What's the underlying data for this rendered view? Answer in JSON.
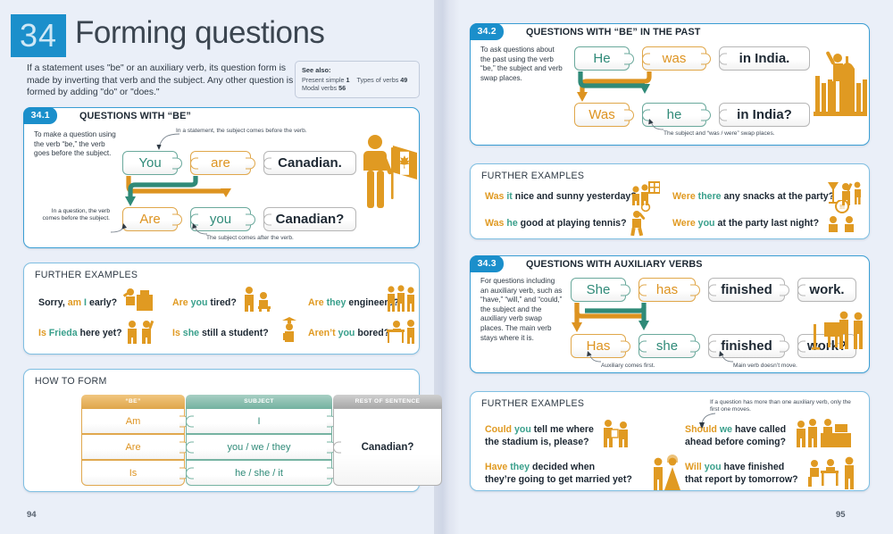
{
  "header": {
    "chapter_number": "34",
    "title": "Forming questions",
    "intro": "If a statement uses \"be\" or an auxiliary verb, its question form is made by inverting that verb and the subject. Any other question is formed by adding \"do\" or \"does.\"",
    "see_also": {
      "label": "See also:",
      "refs": [
        {
          "text": "Present simple",
          "page": "1"
        },
        {
          "text": "Types of verbs",
          "page": "49"
        },
        {
          "text": "Modal verbs",
          "page": "56"
        }
      ]
    }
  },
  "colors": {
    "blue": "#1b8fcb",
    "card_border": "#3a9ed4",
    "orange": "#e09a22",
    "teal": "#3aa08c",
    "page_bg": "#eaeff8"
  },
  "section_341": {
    "badge": "34.1",
    "title": "QUESTIONS WITH “BE”",
    "sidenote": "To make a question using the verb “be,” the verb goes before the subject.",
    "note_top": "In a statement, the subject comes before the verb.",
    "note_bottom_left": "In a question, the verb comes before the subject.",
    "note_bottom_right": "The subject comes after the verb.",
    "row1": [
      {
        "text": "You",
        "type": "subject"
      },
      {
        "text": "are",
        "type": "verb"
      },
      {
        "text": "Canadian.",
        "type": "rest"
      }
    ],
    "row2": [
      {
        "text": "Are",
        "type": "verb"
      },
      {
        "text": "you",
        "type": "subject"
      },
      {
        "text": "Canadian?",
        "type": "rest"
      }
    ],
    "icon": "person-with-canadian-flag-icon"
  },
  "further_examples_left": {
    "title": "FURTHER EXAMPLES",
    "items": [
      {
        "pre": "Sorry, ",
        "verb": "am",
        "subj": "I",
        "post": " early?",
        "icon": "person-at-podium-icon"
      },
      {
        "pre": "",
        "verb": "Are",
        "subj": "you",
        "post": " tired?",
        "icon": "elderly-couple-icon"
      },
      {
        "pre": "",
        "verb": "Are",
        "subj": "they",
        "post": " engineers?",
        "icon": "three-engineers-icon"
      },
      {
        "pre": "",
        "verb": "Is",
        "subj": "Frieda",
        "post": " here yet?",
        "icon": "two-people-waving-icon"
      },
      {
        "pre": "",
        "verb": "Is",
        "subj": "she",
        "post": " still a student?",
        "icon": "graduate-student-icon"
      },
      {
        "pre": "",
        "verb": "Aren’t",
        "subj": "you",
        "post": " bored?",
        "icon": "bored-person-at-desk-icon"
      }
    ]
  },
  "how_to_form": {
    "title": "HOW TO FORM",
    "columns": [
      "“BE”",
      "SUBJECT",
      "REST OF SENTENCE"
    ],
    "rows": [
      {
        "be": "Am",
        "subject": "I"
      },
      {
        "be": "Are",
        "subject": "you / we / they"
      },
      {
        "be": "Is",
        "subject": "he / she / it"
      }
    ],
    "rest": "Canadian?"
  },
  "section_342": {
    "badge": "34.2",
    "title": "QUESTIONS WITH “BE” IN THE PAST",
    "sidenote": "To ask questions about the past using the verb “be,” the subject and verb swap places.",
    "note_bottom": "The subject and “was / were” swap places.",
    "row1": [
      {
        "text": "He",
        "type": "subject"
      },
      {
        "text": "was",
        "type": "verb"
      },
      {
        "text": "in India.",
        "type": "rest"
      }
    ],
    "row2": [
      {
        "text": "Was",
        "type": "verb"
      },
      {
        "text": "he",
        "type": "subject"
      },
      {
        "text": "in India?",
        "type": "rest"
      }
    ],
    "icon": "taj-mahal-traveler-icon"
  },
  "further_examples_mid": {
    "title": "FURTHER EXAMPLES",
    "items": [
      {
        "verb": "Was",
        "subj": "it",
        "post": " nice and sunny yesterday?",
        "icon": "two-people-window-icon"
      },
      {
        "verb": "Were",
        "subj": "there",
        "post": " any snacks at the party?",
        "icon": "party-snacks-icon"
      },
      {
        "verb": "Was",
        "subj": "he",
        "post": " good at playing tennis?",
        "icon": "tennis-player-icon"
      },
      {
        "verb": "Were",
        "subj": "you",
        "post": " at the party last night?",
        "icon": "people-talking-icon"
      }
    ]
  },
  "section_343": {
    "badge": "34.3",
    "title": "QUESTIONS WITH AUXILIARY VERBS",
    "sidenote": "For questions including an auxiliary verb, such as “have,” “will,” and “could,” the subject and the auxiliary verb swap places. The main verb stays where it is.",
    "note_bottom_left": "Auxiliary comes first.",
    "note_bottom_right": "Main verb doesn’t move.",
    "row1": [
      {
        "text": "She",
        "type": "subject"
      },
      {
        "text": "has",
        "type": "verb"
      },
      {
        "text": "finished",
        "type": "rest"
      },
      {
        "text": "work.",
        "type": "rest"
      }
    ],
    "row2": [
      {
        "text": "Has",
        "type": "verb"
      },
      {
        "text": "she",
        "type": "subject"
      },
      {
        "text": "finished",
        "type": "rest"
      },
      {
        "text": "work?",
        "type": "rest"
      }
    ],
    "icon": "office-workers-icon"
  },
  "further_examples_right": {
    "title": "FURTHER EXAMPLES",
    "note": "If a question has more than one auxiliary verb, only the first one moves.",
    "items": [
      {
        "verb": "Could",
        "subj": "you",
        "post": " tell me where",
        "line2": "the stadium is, please?",
        "icon": "two-men-talking-icon"
      },
      {
        "verb": "Should",
        "subj": "we",
        "post": " have called",
        "line2": "ahead before coming?",
        "icon": "reception-desk-icon"
      },
      {
        "verb": "Have",
        "subj": "they",
        "post": " decided when",
        "line2": "they’re going to get married yet?",
        "icon": "wedding-couple-icon"
      },
      {
        "verb": "Will",
        "subj": "you",
        "post": " have finished",
        "line2": "that report by tomorrow?",
        "icon": "office-meeting-icon"
      }
    ]
  },
  "page_numbers": {
    "left": "94",
    "right": "95"
  }
}
